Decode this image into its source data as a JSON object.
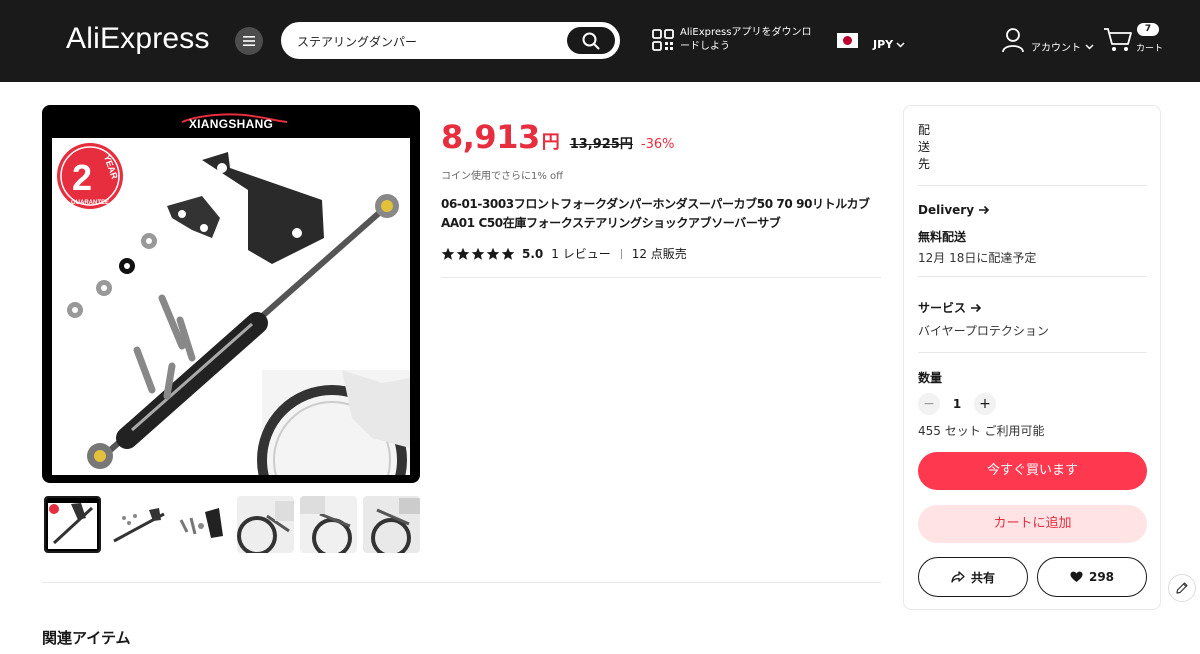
{
  "header": {
    "logo": "AliExpress",
    "search_value": "ステアリングダンパー",
    "app_promo": "AliExpressアプリをダウンロードしよう",
    "currency": "JPY",
    "account_label": "アカウント",
    "cart_label": "カート",
    "cart_count": "7"
  },
  "gallery": {
    "brand": "XIANGSHANG",
    "badge_number": "2",
    "badge_word": "YEAR",
    "badge_sub": "GUARANTEE",
    "thumbnail_count": 6,
    "active_thumbnail": 0
  },
  "product": {
    "price": "8,913",
    "price_unit": "円",
    "original_price": "13,925円",
    "discount": "-36%",
    "coin_note": "コイン使用でさらに1% off",
    "title": "06-01-3003フロントフォークダンパーホンダスーパーカブ50 70 90リトルカブAA01 C50在庫フォークステアリングショックアブソーバーサブ",
    "rating": "5.0",
    "reviews": "1 レビュー",
    "sold": "12 点販売"
  },
  "panel": {
    "ship_to": "配送先",
    "delivery_title": "Delivery",
    "free_shipping": "無料配送",
    "delivery_date": "12月 18日に配達予定",
    "service_title": "サービス",
    "service_value": "バイヤープロテクション",
    "quantity_title": "数量",
    "quantity_value": "1",
    "stock_note": "455 セット ご利用可能",
    "buy_now": "今すぐ買います",
    "add_to_cart": "カートに追加",
    "share": "共有",
    "likes": "298"
  },
  "related_title": "関連アイテム",
  "colors": {
    "header_bg": "#1a1a1a",
    "price_red": "#e62e3f",
    "buy_button": "#fd384f",
    "cart_button_bg": "#ffe3e5"
  }
}
